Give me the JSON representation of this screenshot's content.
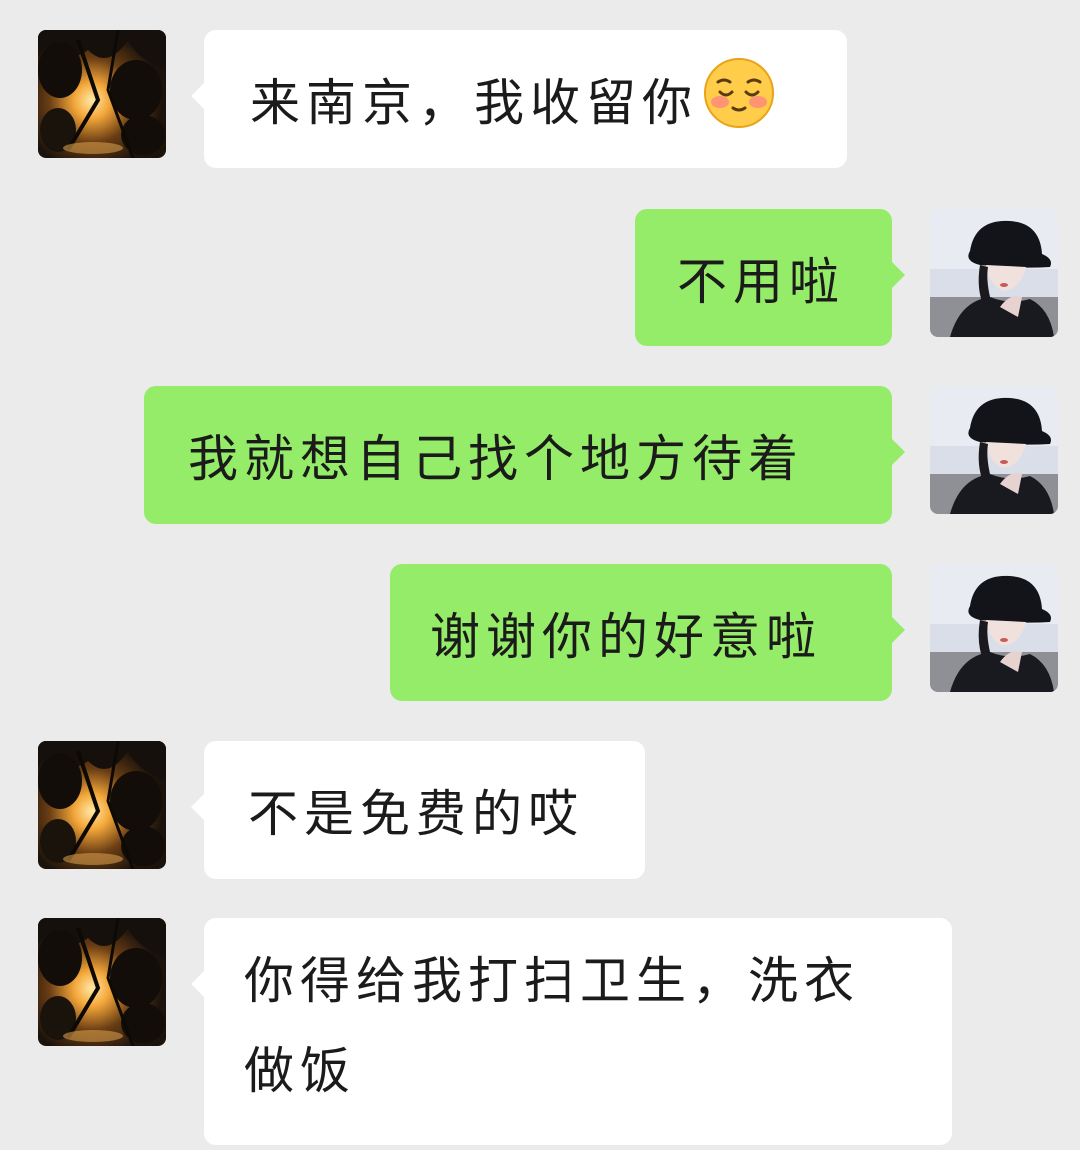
{
  "conversation": {
    "messages": [
      {
        "side": "incoming",
        "text": "来南京，我收留你",
        "emoji": "pleading-blush-face-emoji"
      },
      {
        "side": "outgoing",
        "text": "不用啦"
      },
      {
        "side": "outgoing",
        "text": "我就想自己找个地方待着"
      },
      {
        "side": "outgoing",
        "text": "谢谢你的好意啦"
      },
      {
        "side": "incoming",
        "text": "不是免费的哎"
      },
      {
        "side": "incoming",
        "text": "你得给我打扫卫生，洗衣做饭"
      }
    ]
  },
  "avatars": {
    "contact": "dark-leaves-sunset-avatar",
    "self": "girl-black-bucket-hat-avatar"
  },
  "colors": {
    "background": "#ebebeb",
    "incoming_bubble": "#ffffff",
    "outgoing_bubble": "#95ec69",
    "text": "#1b1b1b"
  }
}
